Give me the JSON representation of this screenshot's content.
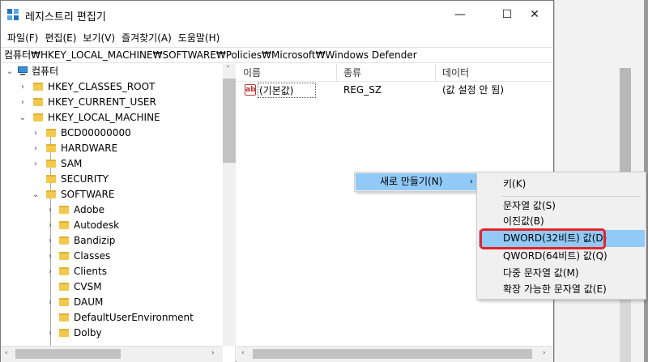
{
  "window": {
    "title": "레지스트리 편집기",
    "controls": {
      "minimize": "—",
      "maximize": "☐",
      "close": "✕"
    }
  },
  "menu": [
    "파일(F)",
    "편집(E)",
    "보기(V)",
    "즐겨찾기(A)",
    "도움말(H)"
  ],
  "address": "컴퓨터₩HKEY_LOCAL_MACHINE₩SOFTWARE₩Policies₩Microsoft₩Windows Defender",
  "tree": {
    "root": "컴퓨터",
    "items": [
      "HKEY_CLASSES_ROOT",
      "HKEY_CURRENT_USER",
      "HKEY_LOCAL_MACHINE",
      "BCD00000000",
      "HARDWARE",
      "SAM",
      "SECURITY",
      "SOFTWARE",
      "Adobe",
      "Autodesk",
      "Bandizip",
      "Classes",
      "Clients",
      "CVSM",
      "DAUM",
      "DefaultUserEnvironment",
      "Dolby"
    ]
  },
  "list": {
    "headers": [
      "이름",
      "종류",
      "데이터"
    ],
    "rows": [
      {
        "name": "(기본값)",
        "type": "REG_SZ",
        "data": "(값 설정 안 됨)"
      }
    ]
  },
  "context_menu": {
    "new": "새로 만들기(N)",
    "submenu": [
      "키(K)",
      "문자열 값(S)",
      "이진값(B)",
      "DWORD(32비트) 값(D)",
      "QWORD(64비트) 값(Q)",
      "다중 문자열 값(M)",
      "확장 가능한 문자열 값(E)"
    ],
    "highlighted": "DWORD(32비트) 값(D)",
    "highlight_color": "#91c9f7",
    "callout_color": "#e3242b"
  },
  "glyphs": {
    "expand": "›",
    "collapse": "⌄",
    "submenu_arrow": "›",
    "left": "‹",
    "right": "›",
    "up": "˄"
  }
}
